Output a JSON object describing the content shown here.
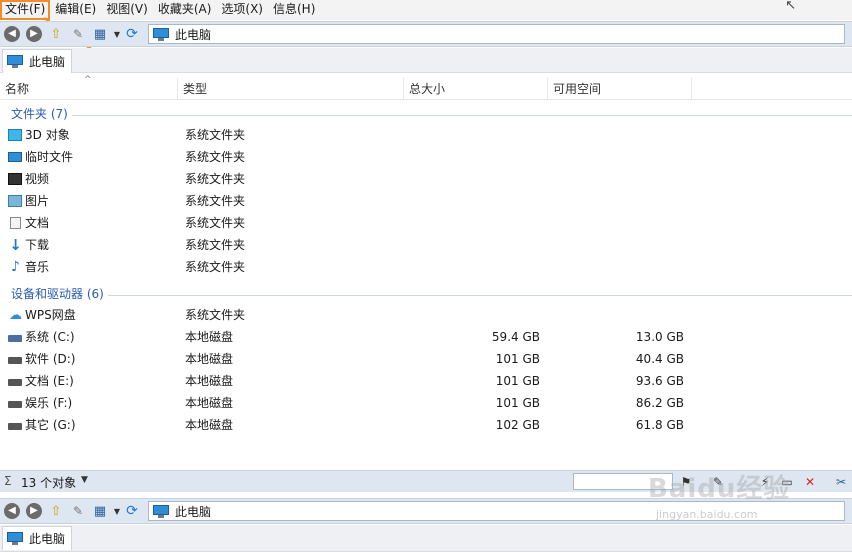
{
  "menu": [
    "文件(F)",
    "编辑(E)",
    "视图(V)",
    "收藏夹(A)",
    "选项(X)",
    "信息(H)"
  ],
  "toolbar": {
    "address": "此电脑"
  },
  "tab_label": "此电脑",
  "columns": [
    "名称",
    "类型",
    "总大小",
    "可用空间"
  ],
  "groups": [
    {
      "title": "文件夹 (7)",
      "items": [
        {
          "name": "3D 对象",
          "type": "系统文件夹",
          "total": "",
          "free": "",
          "icon": "3d-objects-icon"
        },
        {
          "name": "临时文件",
          "type": "系统文件夹",
          "total": "",
          "free": "",
          "icon": "desktop-icon"
        },
        {
          "name": "视频",
          "type": "系统文件夹",
          "total": "",
          "free": "",
          "icon": "video-icon"
        },
        {
          "name": "图片",
          "type": "系统文件夹",
          "total": "",
          "free": "",
          "icon": "picture-icon"
        },
        {
          "name": "文档",
          "type": "系统文件夹",
          "total": "",
          "free": "",
          "icon": "document-icon"
        },
        {
          "name": "下载",
          "type": "系统文件夹",
          "total": "",
          "free": "",
          "icon": "download-icon"
        },
        {
          "name": "音乐",
          "type": "系统文件夹",
          "total": "",
          "free": "",
          "icon": "music-icon"
        }
      ]
    },
    {
      "title": "设备和驱动器 (6)",
      "items": [
        {
          "name": "WPS网盘",
          "type": "系统文件夹",
          "total": "",
          "free": "",
          "icon": "cloud-icon"
        },
        {
          "name": "系统 (C:)",
          "type": "本地磁盘",
          "total": "59.4 GB",
          "free": "13.0 GB",
          "icon": "windows-drive-icon"
        },
        {
          "name": "软件 (D:)",
          "type": "本地磁盘",
          "total": "101 GB",
          "free": "40.4 GB",
          "icon": "drive-icon"
        },
        {
          "name": "文档 (E:)",
          "type": "本地磁盘",
          "total": "101 GB",
          "free": "93.6 GB",
          "icon": "drive-icon"
        },
        {
          "name": "娱乐 (F:)",
          "type": "本地磁盘",
          "total": "101 GB",
          "free": "86.2 GB",
          "icon": "drive-icon"
        },
        {
          "name": "其它 (G:)",
          "type": "本地磁盘",
          "total": "102 GB",
          "free": "61.8 GB",
          "icon": "drive-icon"
        }
      ]
    }
  ],
  "status": {
    "count": "13 个对象"
  },
  "second_pane": {
    "address": "此电脑",
    "tab_label": "此电脑"
  },
  "watermark": {
    "main": "Baidu经验",
    "sub": "jingyan.baidu.com"
  },
  "colors": {
    "highlight": "#f28c28",
    "toolbar": "#dde6f1",
    "group_text": "#2a5db0"
  }
}
